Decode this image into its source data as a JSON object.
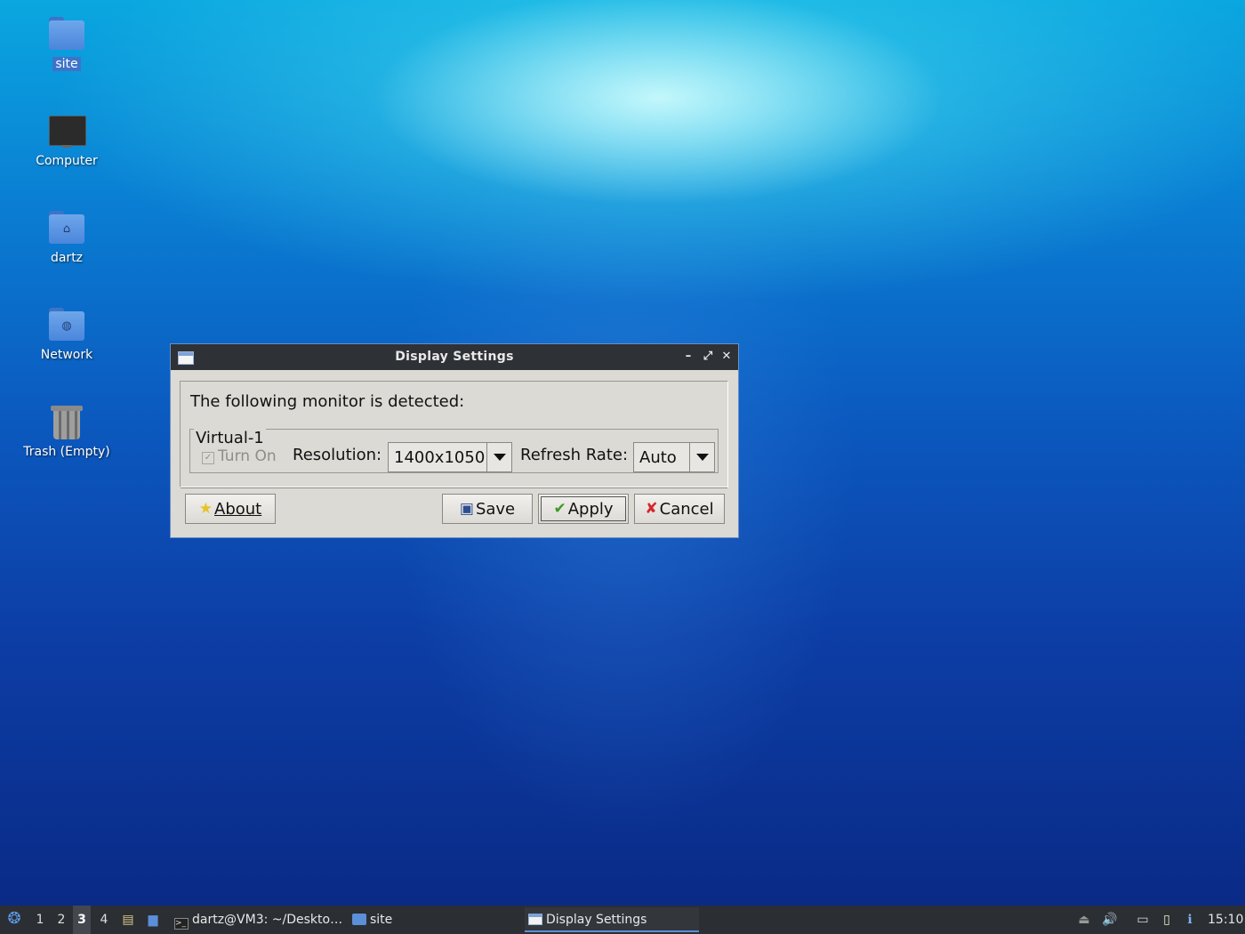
{
  "desktop": {
    "icons": [
      {
        "label": "site",
        "kind": "folder"
      },
      {
        "label": "Computer",
        "kind": "computer"
      },
      {
        "label": "dartz",
        "kind": "home-folder"
      },
      {
        "label": "Network",
        "kind": "network-folder"
      },
      {
        "label": "Trash (Empty)",
        "kind": "trash"
      }
    ]
  },
  "window": {
    "title": "Display Settings",
    "detected_text": "The following monitor is detected:",
    "monitor_name": "Virtual-1",
    "turn_on_label": "Turn On",
    "turn_on_checked": true,
    "resolution_label": "Resolution:",
    "resolution_value": "1400x1050",
    "refresh_label": "Refresh Rate:",
    "refresh_value": "Auto",
    "buttons": {
      "about": "About",
      "save": "Save",
      "apply": "Apply",
      "cancel": "Cancel"
    }
  },
  "taskbar": {
    "desktops": [
      "1",
      "2",
      "3",
      "4"
    ],
    "active_desktop": "3",
    "tasks": [
      {
        "label": "dartz@VM3: ~/Deskto…",
        "icon": "terminal-icon"
      },
      {
        "label": "site",
        "icon": "folder-icon"
      },
      {
        "label": "Display Settings",
        "icon": "display-settings-icon"
      }
    ],
    "clock": "15:10"
  },
  "colors": {
    "titlebar": "#2e3136",
    "window_bg": "#dcdad5",
    "taskbar": "#2b2e33",
    "accent": "#3d73c9"
  }
}
